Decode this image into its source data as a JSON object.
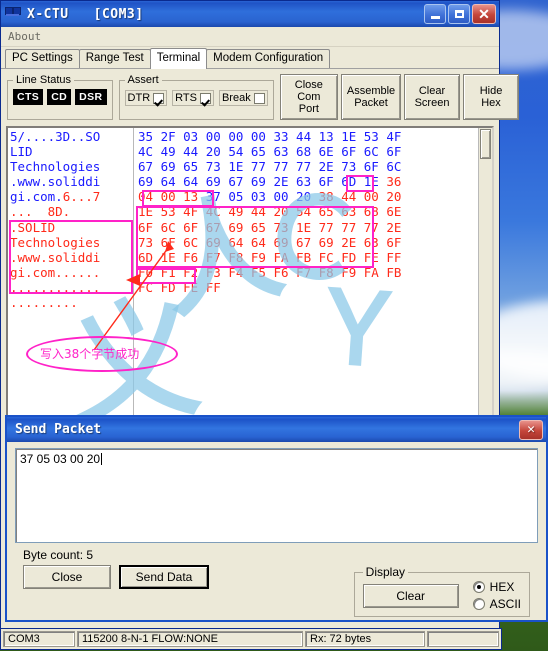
{
  "window": {
    "title": "X-CTU   [COM3]",
    "icon": "modem-icon",
    "buttons": {
      "minimize": "–",
      "maximize": "□",
      "close": "✕"
    }
  },
  "menu": {
    "items": [
      "About"
    ]
  },
  "tabs": [
    {
      "label": "PC Settings",
      "active": false
    },
    {
      "label": "Range Test",
      "active": false
    },
    {
      "label": "Terminal",
      "active": true
    },
    {
      "label": "Modem Configuration",
      "active": false
    }
  ],
  "toolbar": {
    "line_status": {
      "legend": "Line Status",
      "leds": [
        "CTS",
        "CD",
        "DSR"
      ]
    },
    "assert": {
      "legend": "Assert",
      "items": [
        {
          "label": "DTR",
          "checked": true
        },
        {
          "label": "RTS",
          "checked": true
        },
        {
          "label": "Break",
          "checked": false
        }
      ]
    },
    "buttons": [
      {
        "line1": "Close",
        "line2": "Com Port"
      },
      {
        "line1": "Assemble",
        "line2": "Packet"
      },
      {
        "line1": "Clear",
        "line2": "Screen"
      },
      {
        "line1": "Hide",
        "line2": "Hex"
      }
    ]
  },
  "terminal": {
    "ascii_lines": [
      {
        "text": "5/....3D..SO",
        "color": "rx"
      },
      {
        "text": "LID",
        "color": "rx"
      },
      {
        "text": "Technologies",
        "color": "rx"
      },
      {
        "text": ".www.soliddi",
        "color": "rx"
      },
      {
        "text": "gi.com.",
        "color": "rx",
        "text2": "6...7",
        "color2": "tx"
      },
      {
        "text": "...  8D.",
        "color": "tx"
      },
      {
        "text": ".SOLID",
        "color": "tx"
      },
      {
        "text": "Technologies",
        "color": "tx"
      },
      {
        "text": ".www.soliddi",
        "color": "tx"
      },
      {
        "text": "gi.com......",
        "color": "tx"
      },
      {
        "text": "............",
        "color": "tx"
      },
      {
        "text": ".........",
        "color": "tx"
      }
    ],
    "hex_rows": [
      {
        "bytes": [
          "35",
          "2F",
          "03",
          "00",
          "00",
          "00",
          "33",
          "44",
          "13",
          "1E",
          "53",
          "4F"
        ],
        "colors": [
          "rx",
          "rx",
          "rx",
          "rx",
          "rx",
          "rx",
          "rx",
          "rx",
          "rx",
          "rx",
          "rx",
          "rx"
        ]
      },
      {
        "bytes": [
          "4C",
          "49",
          "44",
          "20",
          "54",
          "65",
          "63",
          "68",
          "6E",
          "6F",
          "6C",
          "6F"
        ],
        "colors": [
          "rx",
          "rx",
          "rx",
          "rx",
          "rx",
          "rx",
          "rx",
          "rx",
          "rx",
          "rx",
          "rx",
          "rx"
        ]
      },
      {
        "bytes": [
          "67",
          "69",
          "65",
          "73",
          "1E",
          "77",
          "77",
          "77",
          "2E",
          "73",
          "6F",
          "6C"
        ],
        "colors": [
          "rx",
          "rx",
          "rx",
          "rx",
          "rx",
          "rx",
          "rx",
          "rx",
          "rx",
          "rx",
          "rx",
          "rx"
        ]
      },
      {
        "bytes": [
          "69",
          "64",
          "64",
          "69",
          "67",
          "69",
          "2E",
          "63",
          "6F",
          "6D",
          "1E",
          "36"
        ],
        "colors": [
          "rx",
          "rx",
          "rx",
          "rx",
          "rx",
          "rx",
          "rx",
          "rx",
          "rx",
          "rx",
          "rx",
          "tx"
        ]
      },
      {
        "bytes": [
          "04",
          "00",
          "13",
          "37",
          "05",
          "03",
          "00",
          "20",
          "38",
          "44",
          "00",
          "20"
        ],
        "colors": [
          "tx",
          "tx",
          "tx",
          "rx",
          "rx",
          "rx",
          "rx",
          "rx",
          "tx",
          "tx",
          "tx",
          "tx"
        ]
      },
      {
        "bytes": [
          "1E",
          "53",
          "4F",
          "4C",
          "49",
          "44",
          "20",
          "54",
          "65",
          "63",
          "68",
          "6E"
        ],
        "colors": [
          "tx",
          "tx",
          "tx",
          "tx",
          "tx",
          "tx",
          "tx",
          "tx",
          "tx",
          "tx",
          "tx",
          "tx"
        ]
      },
      {
        "bytes": [
          "6F",
          "6C",
          "6F",
          "67",
          "69",
          "65",
          "73",
          "1E",
          "77",
          "77",
          "77",
          "2E"
        ],
        "colors": [
          "tx",
          "tx",
          "tx",
          "tx",
          "tx",
          "tx",
          "tx",
          "tx",
          "tx",
          "tx",
          "tx",
          "tx"
        ]
      },
      {
        "bytes": [
          "73",
          "6F",
          "6C",
          "69",
          "64",
          "64",
          "69",
          "67",
          "69",
          "2E",
          "63",
          "6F"
        ],
        "colors": [
          "tx",
          "tx",
          "tx",
          "tx",
          "tx",
          "tx",
          "tx",
          "tx",
          "tx",
          "tx",
          "tx",
          "tx"
        ]
      },
      {
        "bytes": [
          "6D",
          "1E",
          "F6",
          "F7",
          "F8",
          "F9",
          "FA",
          "FB",
          "FC",
          "FD",
          "FE",
          "FF"
        ],
        "colors": [
          "tx",
          "tx",
          "tx",
          "tx",
          "tx",
          "tx",
          "tx",
          "tx",
          "tx",
          "tx",
          "tx",
          "tx"
        ]
      },
      {
        "bytes": [
          "F0",
          "F1",
          "F2",
          "F3",
          "F4",
          "F5",
          "F6",
          "F7",
          "F8",
          "F9",
          "FA",
          "FB"
        ],
        "colors": [
          "tx",
          "tx",
          "tx",
          "tx",
          "tx",
          "tx",
          "tx",
          "tx",
          "tx",
          "tx",
          "tx",
          "tx"
        ]
      },
      {
        "bytes": [
          "FC",
          "FD",
          "FE",
          "FF"
        ],
        "colors": [
          "tx",
          "tx",
          "tx",
          "tx"
        ]
      }
    ]
  },
  "annotation": {
    "text": "写入38个字节成功",
    "color": "#ff22c8"
  },
  "watermark": {
    "text": "艾未花IVyC"
  },
  "dialog": {
    "title": "Send Packet",
    "close": "✕",
    "packet_value": "37 05 03 00 20",
    "byte_count_label": "Byte count: 5",
    "close_button": "Close",
    "send_button": "Send Data",
    "display": {
      "legend": "Display",
      "clear_button": "Clear",
      "options": [
        {
          "label": "HEX",
          "selected": true
        },
        {
          "label": "ASCII",
          "selected": false
        }
      ]
    }
  },
  "statusbar": {
    "port": "COM3",
    "settings": "115200 8-N-1  FLOW:NONE",
    "rx": "Rx: 72 bytes",
    "extra": ""
  }
}
